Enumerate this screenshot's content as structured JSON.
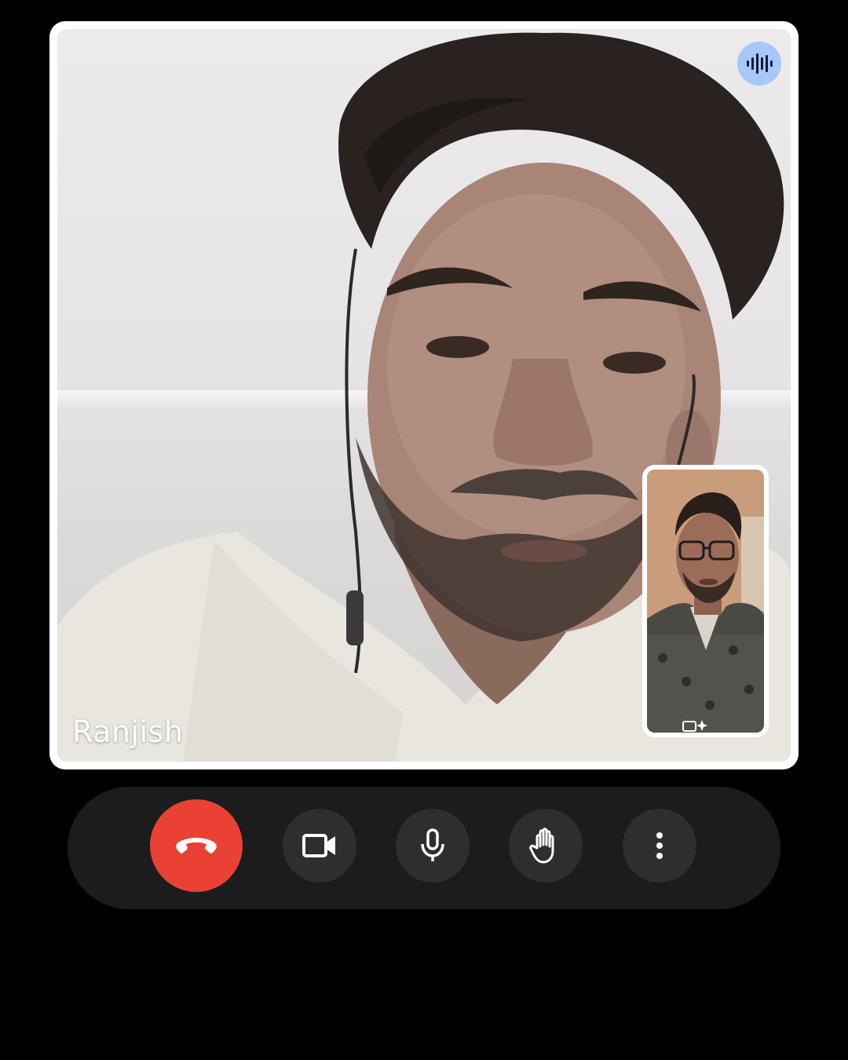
{
  "call": {
    "participant_name": "Ranjish",
    "speaking_indicator": "audio-wave-icon"
  },
  "self_view": {
    "overlay_icon": "effects-icon"
  },
  "controls": [
    {
      "id": "end-call",
      "icon": "phone-hangup-icon",
      "color": "#e94235"
    },
    {
      "id": "camera",
      "icon": "video-camera-icon",
      "color": "#2e2e2e"
    },
    {
      "id": "microphone",
      "icon": "microphone-icon",
      "color": "#2e2e2e"
    },
    {
      "id": "raise-hand",
      "icon": "hand-icon",
      "color": "#2e2e2e"
    },
    {
      "id": "more-options",
      "icon": "more-vertical-icon",
      "color": "#2e2e2e"
    }
  ],
  "colors": {
    "background": "#000000",
    "tile_border": "#ffffff",
    "control_bar": "#1c1c1c",
    "speaking_badge": "#a8c7fa",
    "end_call": "#e94235"
  }
}
